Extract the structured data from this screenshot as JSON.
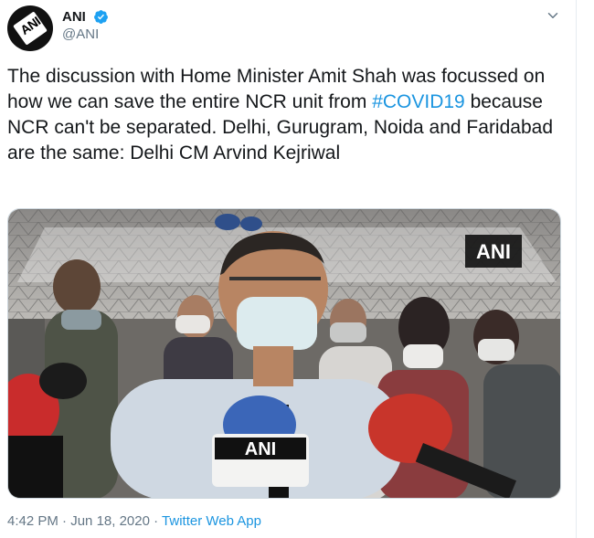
{
  "account": {
    "display_name": "ANI",
    "handle": "@ANI",
    "avatar_text": "ANI",
    "verified": true
  },
  "tweet": {
    "text_before": "The discussion with Home Minister Amit Shah was focussed on how we can save the entire NCR unit from ",
    "hashtag": "#COVID19",
    "text_after": " because NCR can't be separated. Delhi, Gurugram, Noida and Faridabad are the same: Delhi CM Arvind Kejriwal"
  },
  "media": {
    "watermark": "ANI",
    "mic_label": "ANI"
  },
  "meta": {
    "time": "4:42 PM",
    "separator": " · ",
    "date": "Jun 18, 2020",
    "source": "Twitter Web App"
  },
  "colors": {
    "link": "#1b95e0",
    "verified": "#1da1f2",
    "secondary_text": "#657786"
  }
}
